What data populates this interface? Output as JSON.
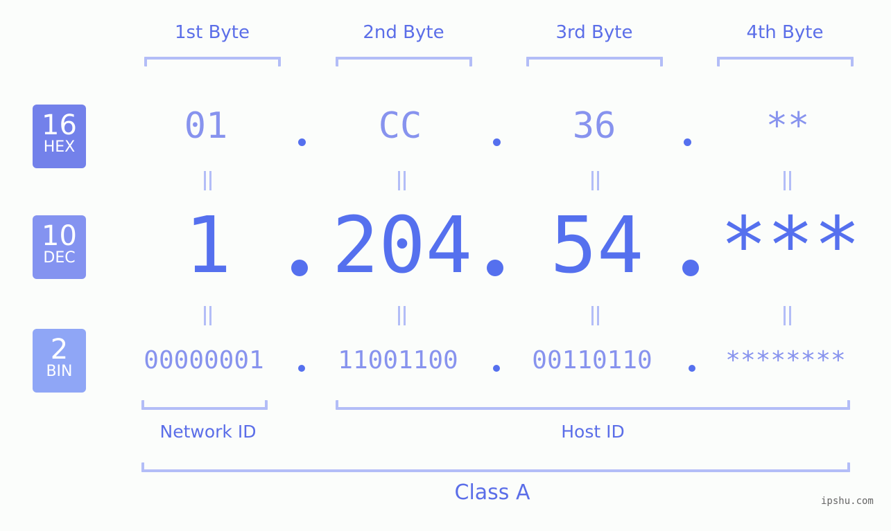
{
  "colors": {
    "hex_badge": "#7381ea",
    "dec_badge": "#8493f0",
    "bin_badge": "#8fa6f6",
    "accent": "#5570ee",
    "muted_value": "#8793ee",
    "bracket": "#b3bdf7",
    "background": "#fbfdfb"
  },
  "byte_headers": [
    "1st Byte",
    "2nd Byte",
    "3rd Byte",
    "4th Byte"
  ],
  "badges": {
    "hex": {
      "number": "16",
      "label": "HEX"
    },
    "dec": {
      "number": "10",
      "label": "DEC"
    },
    "bin": {
      "number": "2",
      "label": "BIN"
    }
  },
  "hex_values": [
    "01",
    "CC",
    "36",
    "**"
  ],
  "dec_values": [
    "1",
    "204",
    "54",
    "***"
  ],
  "bin_values": [
    "00000001",
    "11001100",
    "00110110",
    "********"
  ],
  "separator": ".",
  "equals_icon": "double-vertical-bar",
  "sections": {
    "network_id": "Network ID",
    "host_id": "Host ID",
    "class": "Class A"
  },
  "watermark": "ipshu.com"
}
